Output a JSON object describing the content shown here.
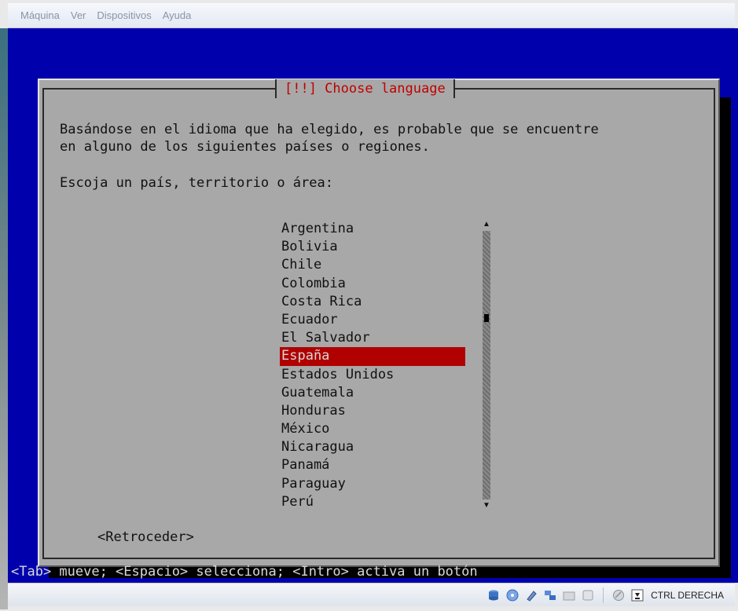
{
  "menu": [
    "Máquina",
    "Ver",
    "Dispositivos",
    "Ayuda"
  ],
  "dialog": {
    "title": "[!!] Choose language",
    "intro_line1": "Basándose en el idioma que ha elegido, es probable que se encuentre",
    "intro_line2": "en alguno de los siguientes países o regiones.",
    "prompt": "Escoja un país, territorio o área:",
    "countries": [
      "Argentina",
      "Bolivia",
      "Chile",
      "Colombia",
      "Costa Rica",
      "Ecuador",
      "El Salvador",
      "España",
      "Estados Unidos",
      "Guatemala",
      "Honduras",
      "México",
      "Nicaragua",
      "Panamá",
      "Paraguay",
      "Perú"
    ],
    "selected": "España",
    "back_button": "<Retroceder>"
  },
  "help_line": "<Tab> mueve; <Espacio> selecciona; <Intro> activa un botón",
  "statusbar": {
    "icons": [
      "hard-disk-icon",
      "optical-drive-icon",
      "usb-icon",
      "network-icon",
      "shared-folders-icon",
      "display-icon",
      "mouse-integration-icon",
      "keyboard-capture-icon"
    ],
    "host_key": "CTRL DERECHA"
  },
  "colors": {
    "screen": "#0000ad",
    "dialog": "#a8a8a8",
    "title": "#c00000",
    "selection": "#b00000"
  }
}
